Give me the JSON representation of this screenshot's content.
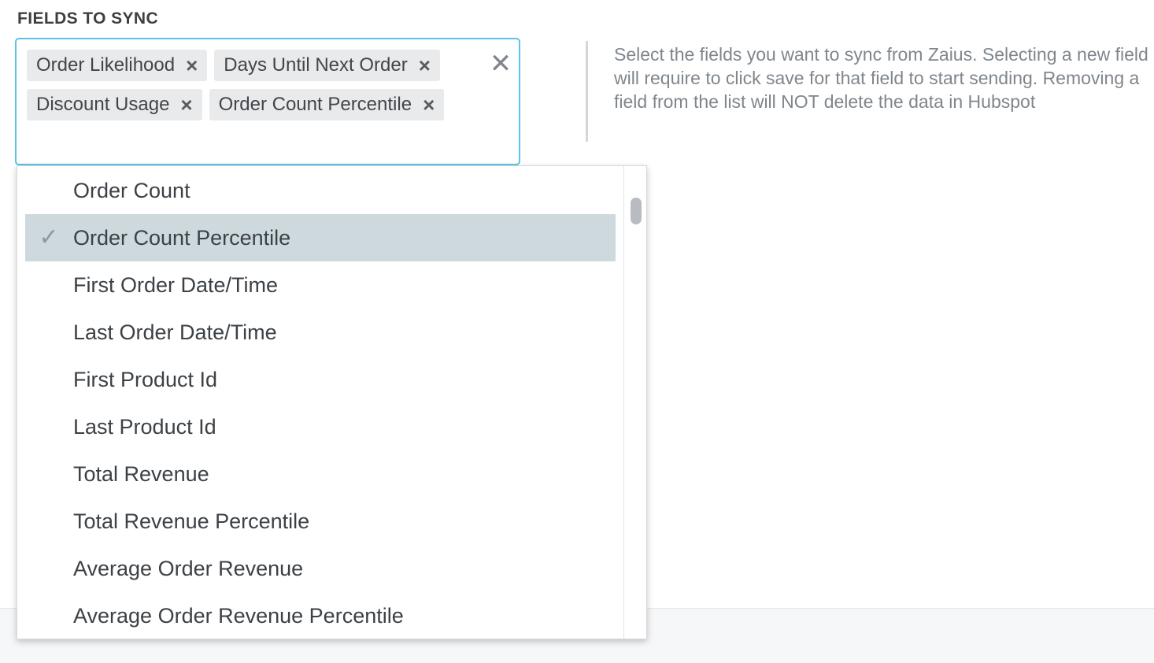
{
  "section_label": "FIELDS TO SYNC",
  "selected_fields": [
    {
      "label": "Order Likelihood",
      "remove_icon": "×"
    },
    {
      "label": "Days Until Next Order",
      "remove_icon": "×"
    },
    {
      "label": "Discount Usage",
      "remove_icon": "×"
    },
    {
      "label": "Order Count Percentile",
      "remove_icon": "×"
    }
  ],
  "clear_icon": "✕",
  "help_text": "Select the fields you want to sync from Zaius. Selecting a new field will require to click save for that field to start sending. Removing a field from the list will NOT delete the data in Hubspot",
  "dropdown": {
    "check_icon": "✓",
    "options": [
      {
        "label": "Order Count",
        "selected": false
      },
      {
        "label": "Order Count Percentile",
        "selected": true
      },
      {
        "label": "First Order Date/Time",
        "selected": false
      },
      {
        "label": "Last Order Date/Time",
        "selected": false
      },
      {
        "label": "First Product Id",
        "selected": false
      },
      {
        "label": "Last Product Id",
        "selected": false
      },
      {
        "label": "Total Revenue",
        "selected": false
      },
      {
        "label": "Total Revenue Percentile",
        "selected": false
      },
      {
        "label": "Average Order Revenue",
        "selected": false
      },
      {
        "label": "Average Order Revenue Percentile",
        "selected": false
      }
    ]
  },
  "colors": {
    "focus_border": "#59c4e6",
    "tag_background": "#e8eaeb",
    "selected_option_background": "#cdd9dd"
  }
}
